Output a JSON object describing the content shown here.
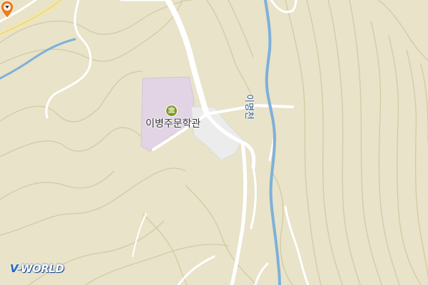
{
  "map": {
    "poi": {
      "name": "이병주문학관",
      "icon": "museum-icon"
    },
    "rivers": [
      {
        "label": "이명천"
      },
      {
        "label": "천"
      }
    ],
    "marker": {
      "icon": "location-pin-icon",
      "color": "#f07d1e"
    },
    "logo": {
      "prefix": "V",
      "text": "-WORLD"
    },
    "colors": {
      "land": "#e8e3c9",
      "contour": "#d6cfa8",
      "road": "#ffffff",
      "water": "#7fb0d9",
      "poi_area": "#e3d3e6",
      "parking": "#ededed"
    }
  }
}
